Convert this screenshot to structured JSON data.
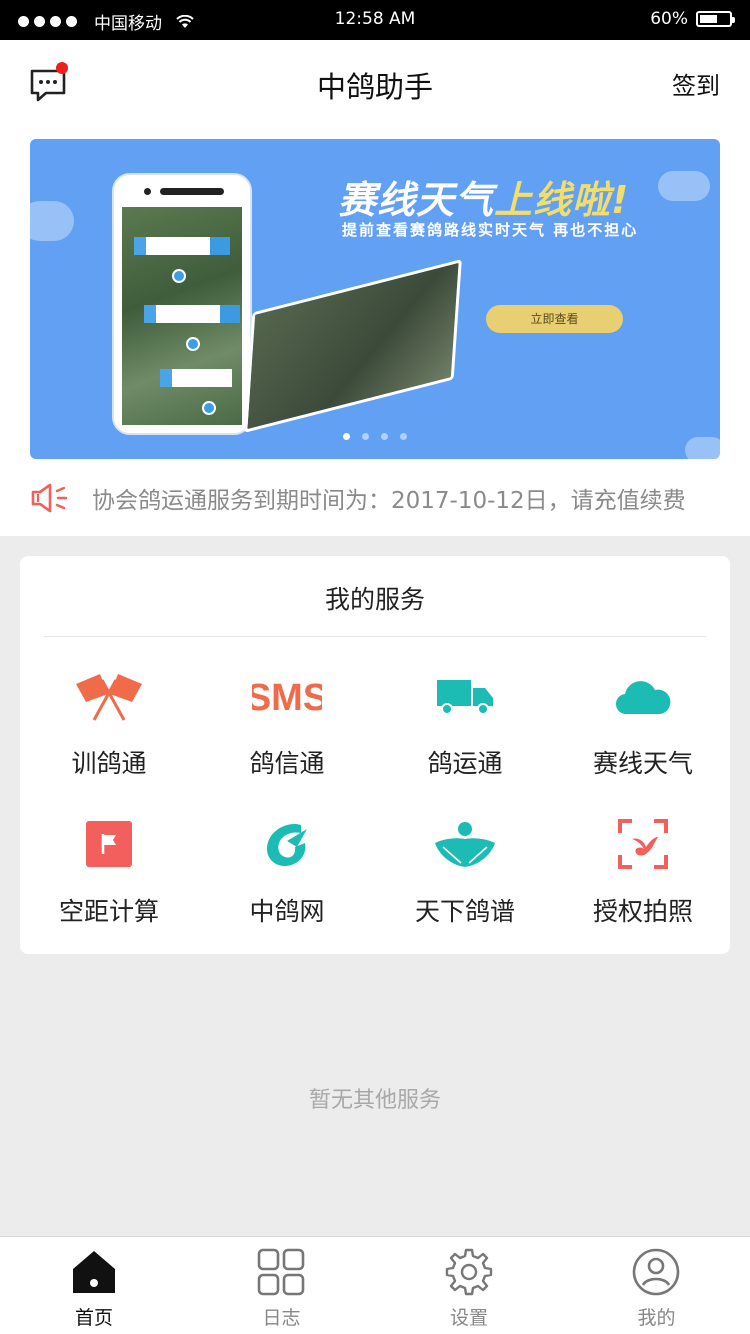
{
  "status_bar": {
    "carrier": "中国移动",
    "time": "12:58  AM",
    "battery_text": "60%",
    "battery_level": 0.6
  },
  "header": {
    "title": "中鸽助手",
    "signin_label": "签到",
    "message_icon": "chat-bubble-icon",
    "has_unread": true
  },
  "banner": {
    "headline_main": "赛线天气",
    "headline_highlight": "上线啦!",
    "subtitle": "提前查看赛鸽路线实时天气  再也不担心",
    "button_label": "立即查看",
    "page_count": 4,
    "active_page": 0
  },
  "notice": {
    "icon": "speaker-icon",
    "text": "协会鸽运通服务到期时间为：2017-10-12日，请充值续费"
  },
  "services": {
    "title": "我的服务",
    "items": [
      {
        "label": "训鸽通",
        "icon": "crossed-flags-icon",
        "color": "#ef6b4a"
      },
      {
        "label": "鸽信通",
        "icon": "sms-icon",
        "color": "#ef6b4a"
      },
      {
        "label": "鸽运通",
        "icon": "truck-icon",
        "color": "#1cbcb5"
      },
      {
        "label": "赛线天气",
        "icon": "cloud-icon",
        "color": "#1cbcb5"
      },
      {
        "label": "空距计算",
        "icon": "flag-icon",
        "color": "#f25f5c"
      },
      {
        "label": "中鸽网",
        "icon": "pigeon-logo-icon",
        "color": "#1cbcb5"
      },
      {
        "label": "天下鸽谱",
        "icon": "pigeon-wings-icon",
        "color": "#1cbcb5"
      },
      {
        "label": "授权拍照",
        "icon": "scan-bird-icon",
        "color": "#f25f5c"
      }
    ],
    "empty_text": "暂无其他服务"
  },
  "tabbar": {
    "tabs": [
      {
        "label": "首页",
        "icon": "home-icon",
        "active": true
      },
      {
        "label": "日志",
        "icon": "grid-icon",
        "active": false
      },
      {
        "label": "设置",
        "icon": "gear-icon",
        "active": false
      },
      {
        "label": "我的",
        "icon": "user-icon",
        "active": false
      }
    ]
  }
}
